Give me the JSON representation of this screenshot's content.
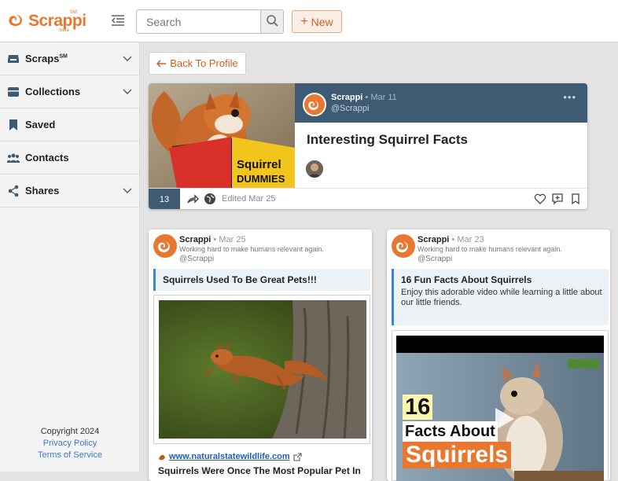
{
  "header": {
    "logo_text": "Scrappi",
    "logo_sm": "SM",
    "logo_beta": "beta",
    "search_placeholder": "Search",
    "new_label": "New"
  },
  "sidebar": {
    "items": [
      {
        "label": "Scraps",
        "sup": "SM",
        "icon": "inbox-icon",
        "expandable": true
      },
      {
        "label": "Collections",
        "icon": "collections-icon",
        "expandable": true
      },
      {
        "label": "Saved",
        "icon": "bookmark-icon",
        "expandable": false
      },
      {
        "label": "Contacts",
        "icon": "contacts-icon",
        "expandable": false
      },
      {
        "label": "Shares",
        "icon": "share-icon",
        "expandable": true
      }
    ],
    "footer": {
      "copyright": "Copyright 2024",
      "privacy": "Privacy Policy",
      "terms": "Terms of Service"
    }
  },
  "main": {
    "back_label": "Back To Profile",
    "feature": {
      "author": "Scrappi",
      "date": "Mar 11",
      "handle": "@Scrappi",
      "title": "Interesting Squirrel Facts",
      "image_book_title_1": "Squirrel",
      "image_book_title_2": "DUMMIES",
      "count": "13",
      "edited": "Edited Mar 25"
    },
    "cards": [
      {
        "author": "Scrappi",
        "date": "Mar 25",
        "tagline": "Working hard to make humans relevant again.",
        "handle": "@Scrappi",
        "note_title": "Squirrels Used To Be Great Pets!!!",
        "link_url": "www.naturalstatewildlife.com",
        "link_title": "Squirrels Were Once The Most Popular Pet In"
      },
      {
        "author": "Scrappi",
        "date": "Mar 23",
        "tagline": "Working hard to make humans relevant again.",
        "handle": "@Scrappi",
        "note_title": "16 Fun Facts About Squirrels",
        "note_body": "Enjoy this adorable video while learning a little about our little friends.",
        "video_title_1": "16",
        "video_title_2": "Facts About",
        "video_title_3": "Squirrels"
      }
    ]
  },
  "colors": {
    "brand": "#e8782f",
    "header_navy": "#3e5b73",
    "link_blue": "#3a7ac8"
  }
}
